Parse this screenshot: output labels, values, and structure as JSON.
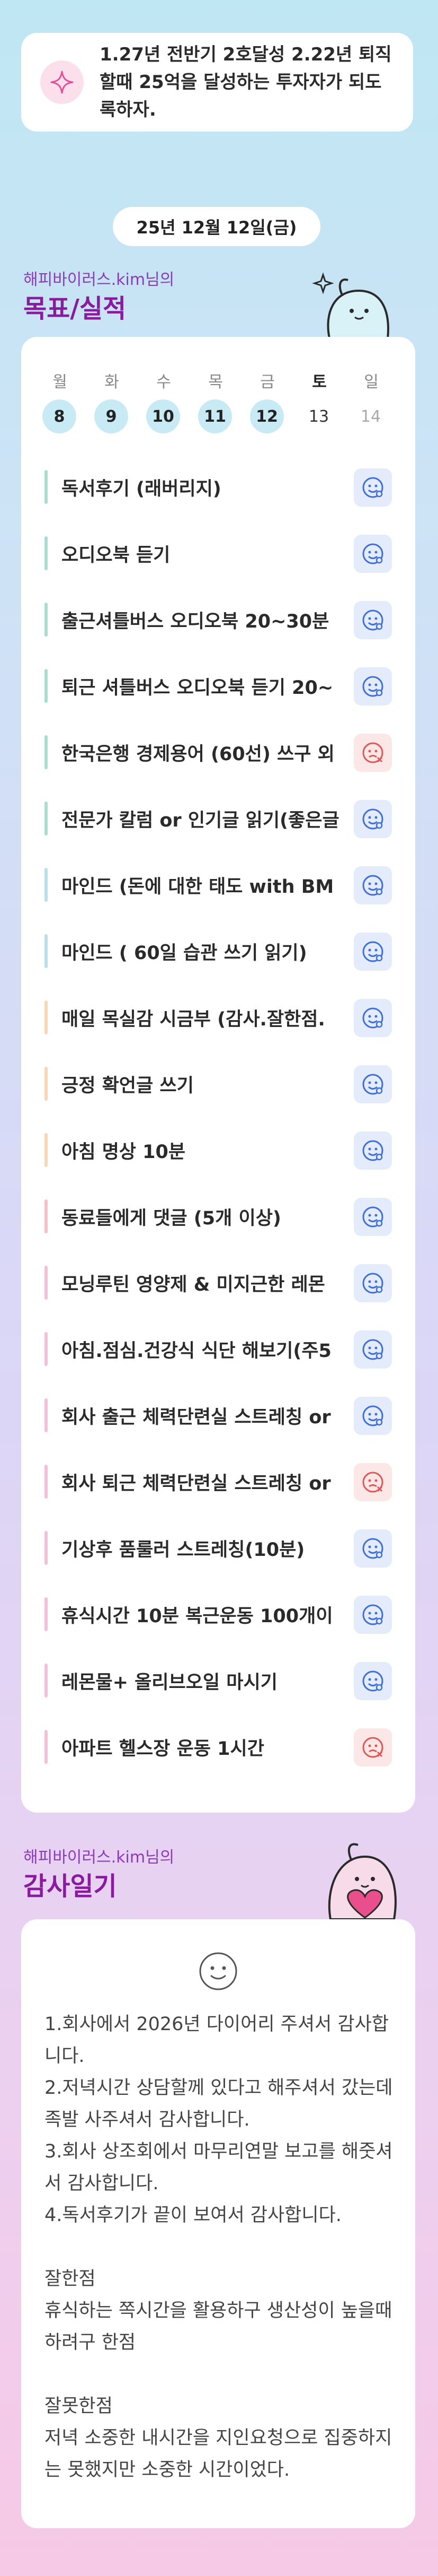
{
  "goal": {
    "icon": "sparkle-icon",
    "text": "1.27년 전반기 2호달성 2.22년 퇴직할때 25억을 달성하는 투자자가 되도록하자."
  },
  "date": "25년 12월 12일(금)",
  "goals_section": {
    "label": "해피바이러스.kim님의",
    "title": "목표/실적"
  },
  "week": [
    {
      "name": "월",
      "num": "8",
      "state": "done"
    },
    {
      "name": "화",
      "num": "9",
      "state": "done"
    },
    {
      "name": "수",
      "num": "10",
      "state": "done"
    },
    {
      "name": "목",
      "num": "11",
      "state": "done"
    },
    {
      "name": "금",
      "num": "12",
      "state": "done"
    },
    {
      "name": "토",
      "num": "13",
      "state": "plain"
    },
    {
      "name": "일",
      "num": "14",
      "state": "sun"
    }
  ],
  "tasks": [
    {
      "name": "독서후기 (래버리지)",
      "status": "ok",
      "color": "#a8ddd0"
    },
    {
      "name": "오디오북 듣기",
      "status": "ok",
      "color": "#a8ddd0"
    },
    {
      "name": "출근셔틀버스 오디오북 20~30분",
      "status": "ok",
      "color": "#a8ddd0"
    },
    {
      "name": "퇴근 셔틀버스 오디오북 듣기 20~",
      "status": "ok",
      "color": "#a8ddd0"
    },
    {
      "name": "한국은행 경제용어 (60선) 쓰구 외",
      "status": "no",
      "color": "#a8ddd0"
    },
    {
      "name": "전문가 칼럼 or 인기글 읽기(좋은글",
      "status": "ok",
      "color": "#a8ddd0"
    },
    {
      "name": "마인드 (돈에 대한 태도 with BM",
      "status": "ok",
      "color": "#b9e0ea"
    },
    {
      "name": "마인드 ( 60일 습관 쓰기 읽기)",
      "status": "ok",
      "color": "#b9e0ea"
    },
    {
      "name": "매일 목실감 시금부 (감사.잘한점.",
      "status": "ok",
      "color": "#f8d6b8"
    },
    {
      "name": "긍정 확언글 쓰기",
      "status": "ok",
      "color": "#f8d6b8"
    },
    {
      "name": "아침 명상 10분",
      "status": "ok",
      "color": "#f8d6b8"
    },
    {
      "name": "동료들에게 댓글 (5개 이상)",
      "status": "ok",
      "color": "#f4c0cc"
    },
    {
      "name": "모닝루틴 영양제 & 미지근한 레몬",
      "status": "ok",
      "color": "#f4c0d8"
    },
    {
      "name": "아침.점심.건강식 식단 해보기(주5",
      "status": "ok",
      "color": "#f4c0d8"
    },
    {
      "name": "회사 출근 체력단련실 스트레칭 or",
      "status": "ok",
      "color": "#f4c0d8"
    },
    {
      "name": "회사 퇴근 체력단련실 스트레칭 or",
      "status": "no",
      "color": "#f4c0d8"
    },
    {
      "name": "기상후 품룰러 스트레칭(10분)",
      "status": "ok",
      "color": "#f4c0d8"
    },
    {
      "name": "휴식시간 10분 복근운동 100개이",
      "status": "ok",
      "color": "#f4c0d8"
    },
    {
      "name": "레몬물+ 올리브오일 마시기",
      "status": "ok",
      "color": "#f4c0d8"
    },
    {
      "name": "아파트 헬스장 운동 1시간",
      "status": "no",
      "color": "#f4c0d8"
    }
  ],
  "diary_section": {
    "label": "해피바이러스.kim님의",
    "title": "감사일기"
  },
  "diary": {
    "text": "1.회사에서 2026년 다이어리 주셔서 감사합니다.\n2.저녁시간 상담할께 있다고 해주셔서 갔는데 족발 사주셔서 감사합니다.\n3.회사 상조회에서 마무리연말 보고를 해줏셔서 감사합니다.\n4.독서후기가 끝이 보여서 감사합니다.\n\n잘한점\n휴식하는 쪽시간을 활용하구 생산성이 높을때 하려구 한점\n\n잘못한점\n저녁 소중한 내시간을 지인요청으로 집중하지는 못했지만 소중한 시간이었다."
  }
}
